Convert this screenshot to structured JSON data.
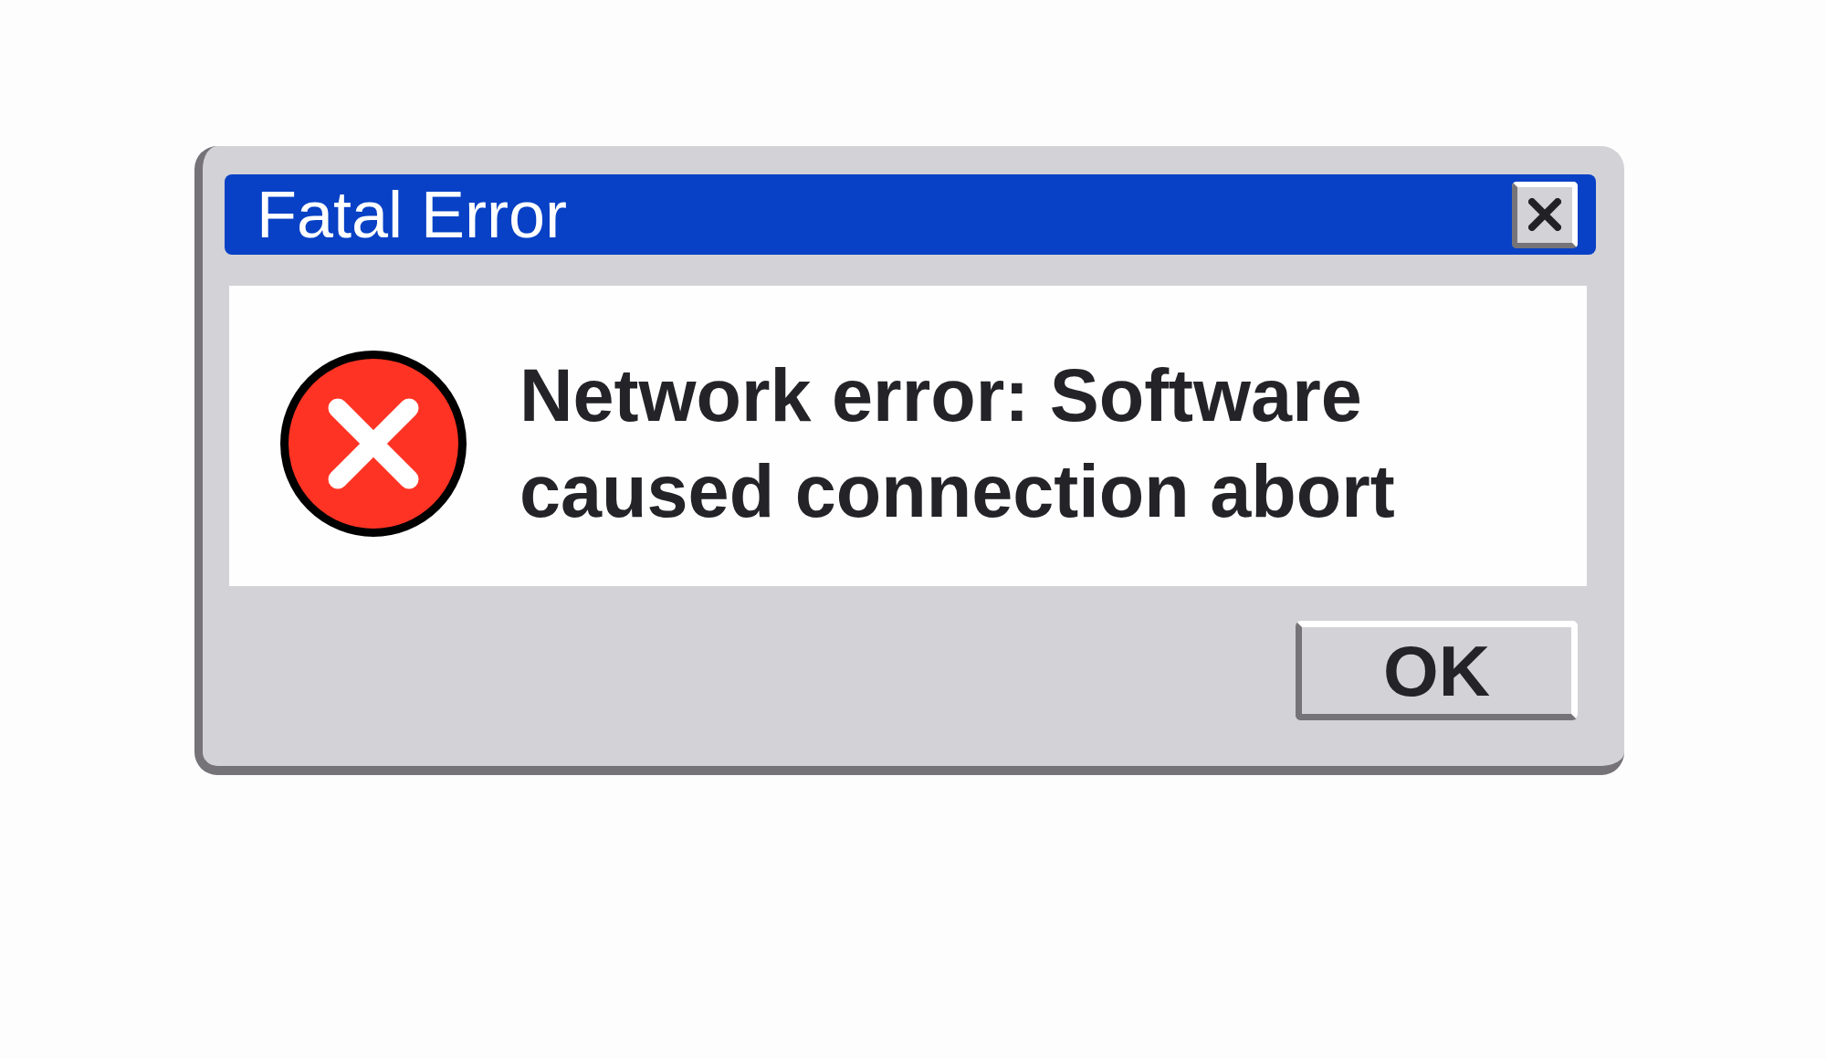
{
  "window": {
    "title": "Fatal Error"
  },
  "message": {
    "text": "Network error: Software caused connection abort"
  },
  "buttons": [
    {
      "label": "OK"
    }
  ]
}
